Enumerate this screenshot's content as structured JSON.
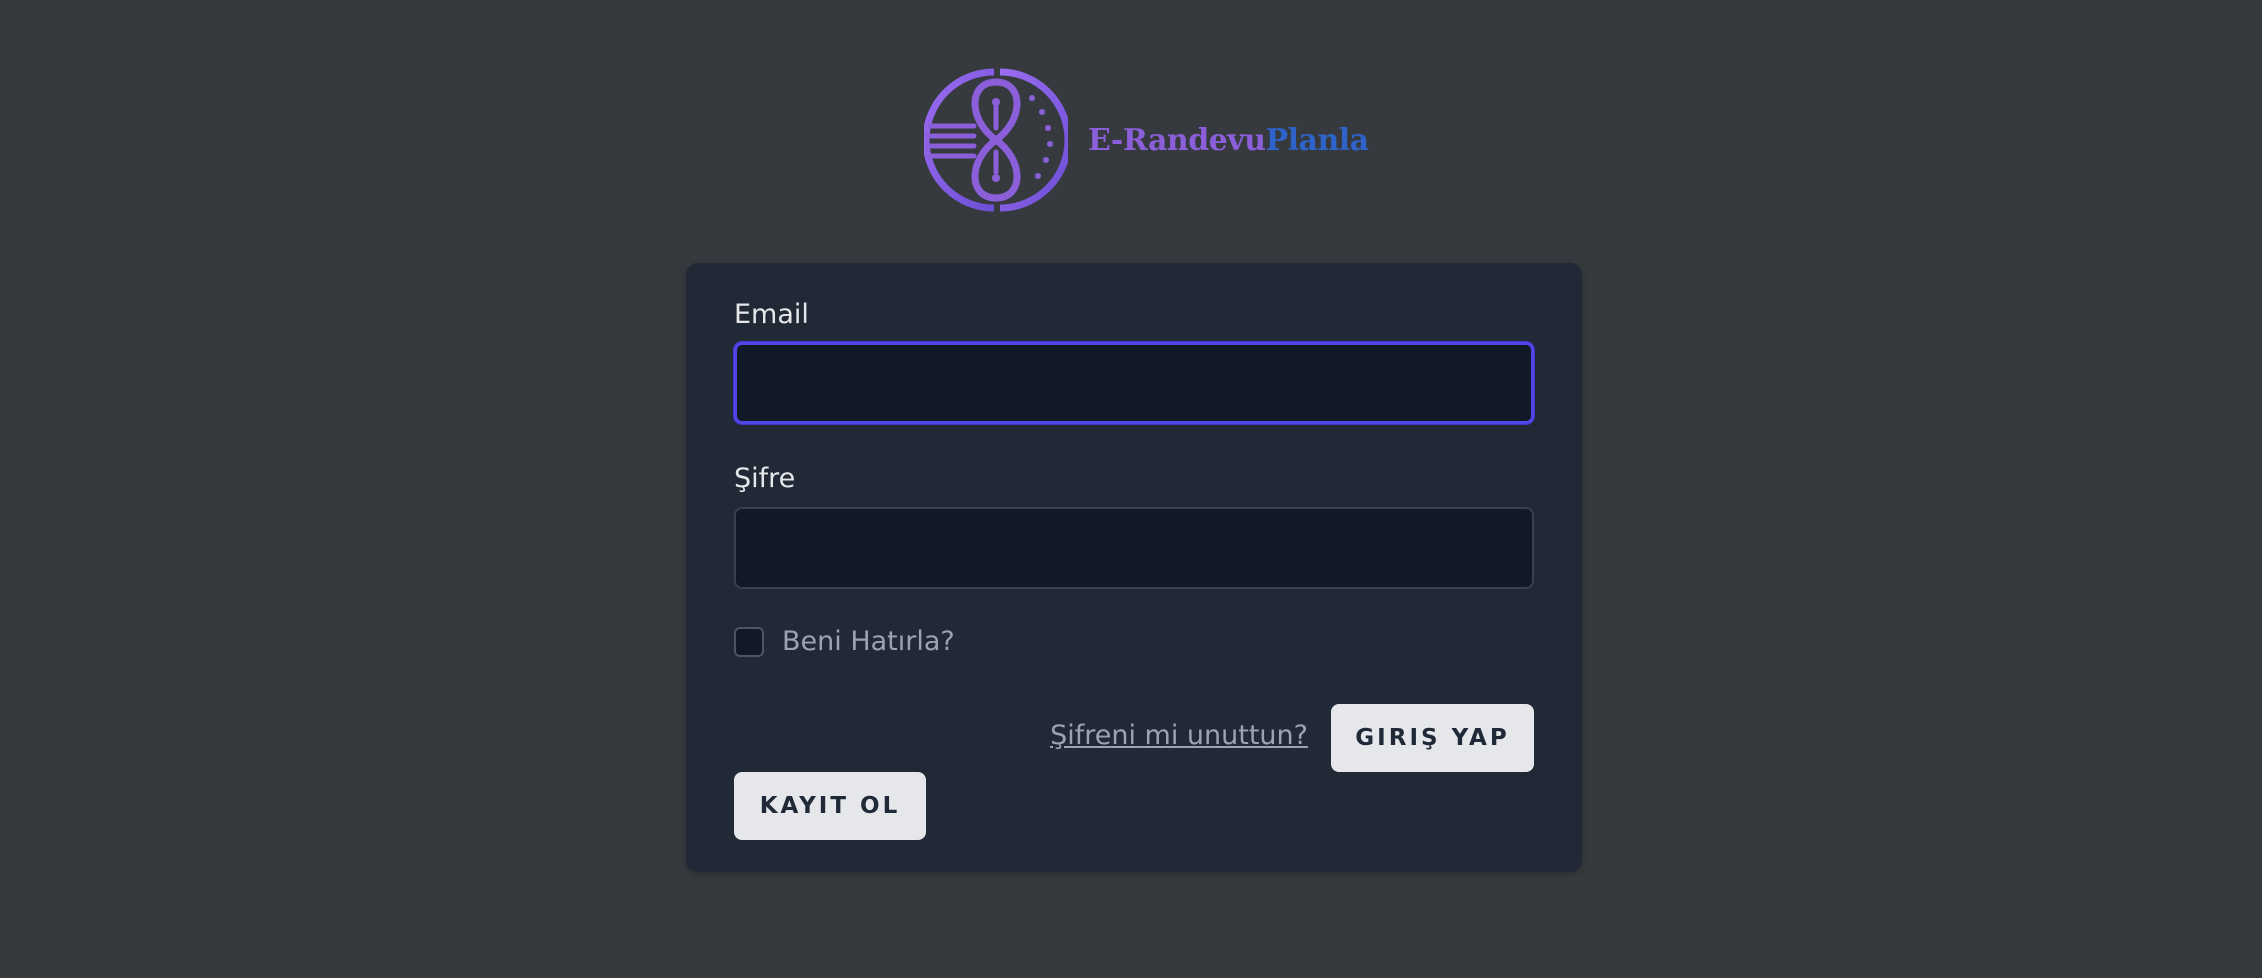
{
  "brand": {
    "name_part1": "E-Randevu",
    "name_part2": "Planla",
    "logo_icon": "infinity-clock-icon",
    "colors": {
      "primary": "#8b5fd9",
      "secondary": "#2e64c9"
    }
  },
  "form": {
    "email": {
      "label": "Email",
      "value": "",
      "placeholder": ""
    },
    "password": {
      "label": "Şifre",
      "value": "",
      "placeholder": ""
    },
    "remember": {
      "label": "Beni Hatırla?",
      "checked": false
    },
    "forgot_link": "Şifreni mi unuttun?",
    "login_button": "GIRIŞ YAP",
    "register_button": "KAYIT OL"
  },
  "colors": {
    "background": "#363a3f",
    "card": "#212836",
    "input_bg": "#111827",
    "focus_ring": "#4f46e5",
    "button_bg": "#e5e7eb"
  }
}
